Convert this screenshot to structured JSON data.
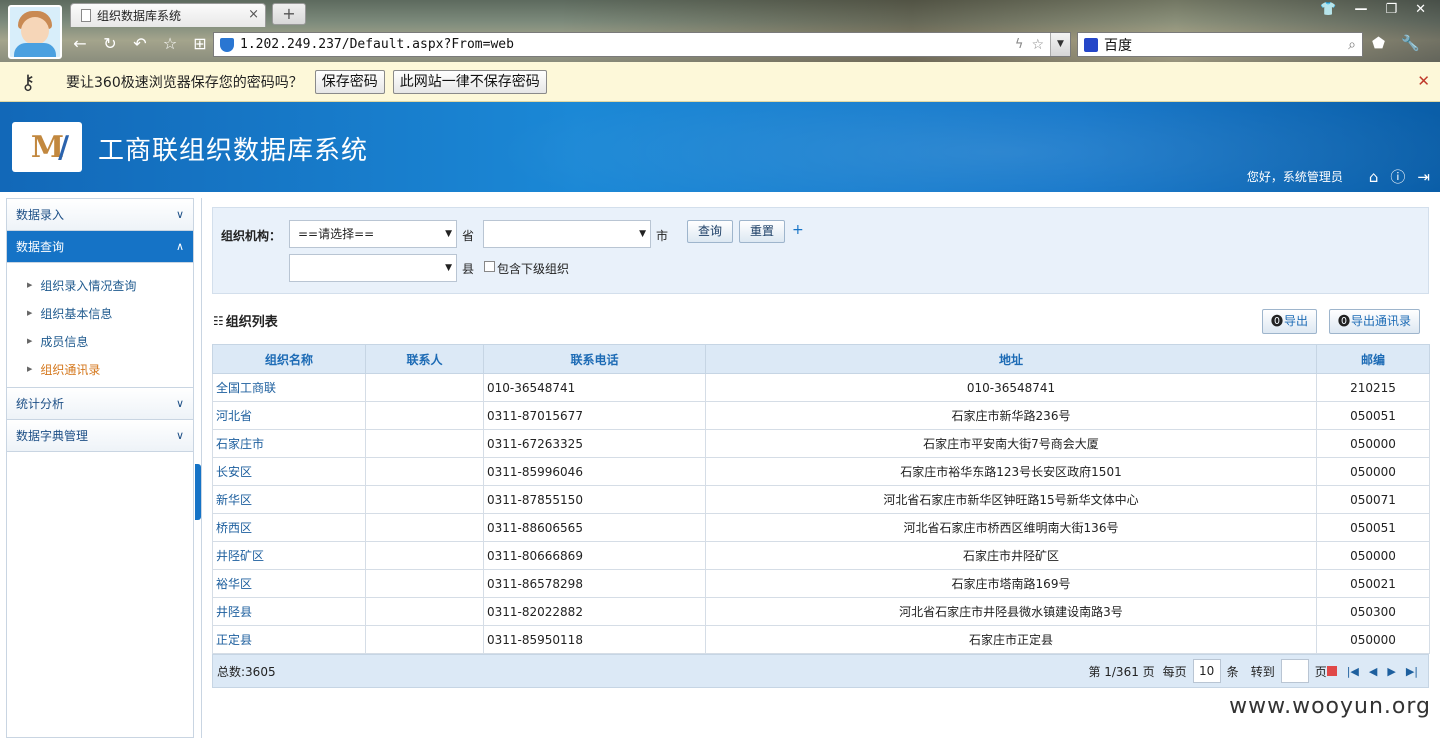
{
  "browser": {
    "tab_title": "组织数据库系统",
    "tab_close": "×",
    "new_tab": "+",
    "url": "1.202.249.237/Default.aspx?From=web",
    "search_engine": "百度",
    "window_controls": [
      "👕",
      "—",
      "❐",
      "✕"
    ],
    "nav_icons": [
      "back-icon",
      "refresh-icon",
      "undo-icon",
      "star-icon",
      "grid-icon"
    ]
  },
  "password_bar": {
    "message": "要让360极速浏览器保存您的密码吗？",
    "save_button": "保存密码",
    "never_button": "此网站一律不保存密码",
    "close": "✕"
  },
  "app": {
    "title": "工商联组织数据库系统",
    "greeting": "您好，系统管理员",
    "logo_text": "M"
  },
  "sidebar": {
    "menus": [
      {
        "label": "数据录入",
        "expanded": false
      },
      {
        "label": "数据查询",
        "expanded": true
      },
      {
        "label": "统计分析",
        "expanded": false
      },
      {
        "label": "数据字典管理",
        "expanded": false
      }
    ],
    "query_items": [
      "组织录入情况查询",
      "组织基本信息",
      "成员信息",
      "组织通讯录"
    ],
    "current_item": "组织通讯录"
  },
  "filter": {
    "label": "组织机构：",
    "province_value": "==请选择==",
    "province_unit": "省",
    "city_value": "",
    "city_unit": "市",
    "county_value": "",
    "county_unit": "县",
    "include_sub_label": "包含下级组织",
    "include_sub_checked": false,
    "query_button": "查询",
    "reset_button": "重置",
    "plus": "+"
  },
  "list": {
    "title": "组织列表",
    "export_button": "导出",
    "export_contacts_button": "导出通讯录",
    "columns": [
      "组织名称",
      "联系人",
      "联系电话",
      "地址",
      "邮编"
    ],
    "rows": [
      {
        "name": "全国工商联",
        "contact": "",
        "phone": "010-36548741",
        "address": "010-36548741",
        "zip": "210215"
      },
      {
        "name": "河北省",
        "contact": "",
        "phone": "0311-87015677",
        "address": "石家庄市新华路236号",
        "zip": "050051"
      },
      {
        "name": "石家庄市",
        "contact": "",
        "phone": "0311-67263325",
        "address": "石家庄市平安南大街7号商会大厦",
        "zip": "050000"
      },
      {
        "name": "长安区",
        "contact": "",
        "phone": "0311-85996046",
        "address": "石家庄市裕华东路123号长安区政府1501",
        "zip": "050000"
      },
      {
        "name": "新华区",
        "contact": "",
        "phone": "0311-87855150",
        "address": "河北省石家庄市新华区钟旺路15号新华文体中心",
        "zip": "050071"
      },
      {
        "name": "桥西区",
        "contact": "",
        "phone": "0311-88606565",
        "address": "河北省石家庄市桥西区维明南大街136号",
        "zip": "050051"
      },
      {
        "name": "井陉矿区",
        "contact": "",
        "phone": "0311-80666869",
        "address": "石家庄市井陉矿区",
        "zip": "050000"
      },
      {
        "name": "裕华区",
        "contact": "",
        "phone": "0311-86578298",
        "address": "石家庄市塔南路169号",
        "zip": "050021"
      },
      {
        "name": "井陉县",
        "contact": "",
        "phone": "0311-82022882",
        "address": "河北省石家庄市井陉县微水镇建设南路3号",
        "zip": "050300"
      },
      {
        "name": "正定县",
        "contact": "",
        "phone": "0311-85950118",
        "address": "石家庄市正定县",
        "zip": "050000"
      }
    ]
  },
  "pager": {
    "total": "总数:3605",
    "page_info": "第 1/361 页",
    "per_page_label": "每页",
    "per_page_value": "10",
    "per_page_unit": "条",
    "goto_label": "转到",
    "goto_unit": "页"
  },
  "watermark": "www.wooyun.org",
  "colors": {
    "header_blue": "#1573c6",
    "link_blue": "#1d5f9e",
    "active_orange": "#d4771c",
    "table_header_bg": "#dce9f6"
  }
}
